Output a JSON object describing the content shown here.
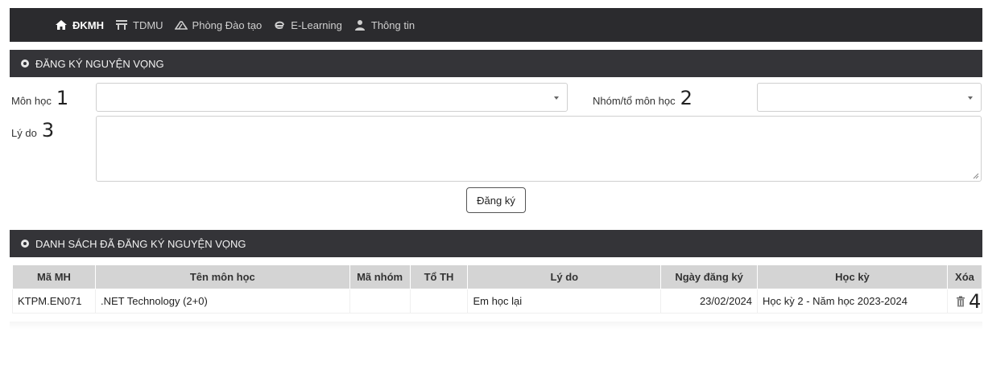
{
  "nav": {
    "items": [
      {
        "label": "ĐKMH",
        "icon": "home-icon"
      },
      {
        "label": "TDMU",
        "icon": "building-icon"
      },
      {
        "label": "Phòng Đào tạo",
        "icon": "road-icon"
      },
      {
        "label": "E-Learning",
        "icon": "e-icon"
      },
      {
        "label": "Thông tin",
        "icon": "user-icon"
      }
    ]
  },
  "form": {
    "title": "ĐĂNG KÝ NGUYỆN VỌNG",
    "subject_label": "Môn học",
    "subject_num": "1",
    "group_label": "Nhóm/tổ môn học",
    "group_num": "2",
    "reason_label": "Lý do",
    "reason_num": "3",
    "submit_label": "Đăng ký"
  },
  "list": {
    "title": "DANH SÁCH ĐÃ ĐĂNG KÝ NGUYỆN VỌNG",
    "columns": [
      "Mã MH",
      "Tên môn học",
      "Mã nhóm",
      "Tổ TH",
      "Lý do",
      "Ngày đăng ký",
      "Học kỳ",
      "Xóa"
    ],
    "rows": [
      {
        "code": "KTPM.EN071",
        "name": ".NET Technology (2+0)",
        "group": "",
        "team": "",
        "reason": "Em học lại",
        "date": "23/02/2024",
        "semester": "Học kỳ 2 - Năm học 2023-2024",
        "delete_num": "4"
      }
    ]
  },
  "colors": {
    "header_bg": "#2b2b2e",
    "panel_bg": "#343438",
    "table_head": "#d4d4d4"
  }
}
